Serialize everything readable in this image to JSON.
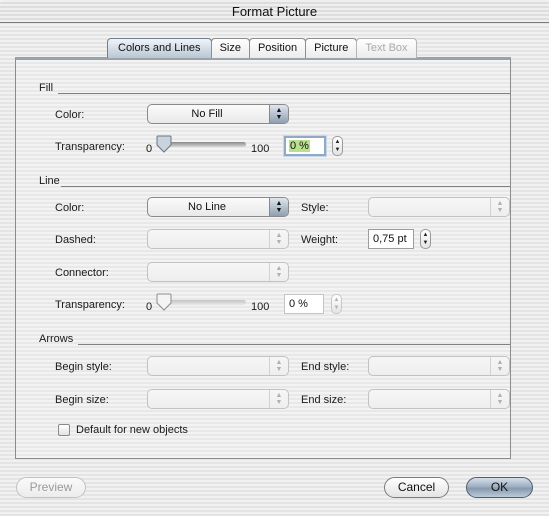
{
  "window": {
    "title": "Format Picture"
  },
  "tabs": [
    {
      "label": "Colors and Lines",
      "active": true,
      "enabled": true
    },
    {
      "label": "Size",
      "active": false,
      "enabled": true
    },
    {
      "label": "Position",
      "active": false,
      "enabled": true
    },
    {
      "label": "Picture",
      "active": false,
      "enabled": true
    },
    {
      "label": "Text Box",
      "active": false,
      "enabled": false
    }
  ],
  "fill": {
    "section_label": "Fill",
    "color_label": "Color:",
    "color_value": "No Fill",
    "transparency_label": "Transparency:",
    "slider_min": "0",
    "slider_max": "100",
    "transparency_percent": 0,
    "transparency_value": "0 %"
  },
  "line": {
    "section_label": "Line",
    "color_label": "Color:",
    "color_value": "No Line",
    "style_label": "Style:",
    "style_value": "",
    "dashed_label": "Dashed:",
    "dashed_value": "",
    "weight_label": "Weight:",
    "weight_value": "0,75 pt",
    "connector_label": "Connector:",
    "connector_value": "",
    "transparency_label": "Transparency:",
    "slider_min": "0",
    "slider_max": "100",
    "transparency_percent": 0,
    "transparency_value": "0 %"
  },
  "arrows": {
    "section_label": "Arrows",
    "begin_style_label": "Begin style:",
    "end_style_label": "End style:",
    "begin_size_label": "Begin size:",
    "end_size_label": "End size:"
  },
  "default_checkbox": {
    "label": "Default for new objects",
    "checked": false
  },
  "buttons": {
    "preview": "Preview",
    "cancel": "Cancel",
    "ok": "OK"
  },
  "icons": {
    "popup_arrows": "▲▼",
    "stepper_arrows": "▲▼"
  }
}
